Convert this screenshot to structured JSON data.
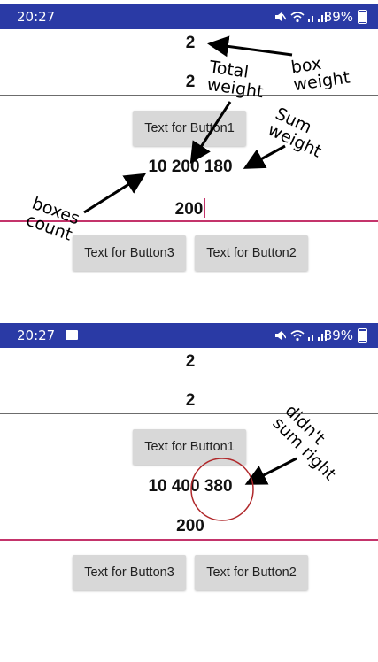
{
  "screen1": {
    "status": {
      "time": "20:27",
      "battery": "89%"
    },
    "box_weight": "2",
    "boxes_count_value": "2",
    "button1": "Text for Button1",
    "sum_text": "10 200 180",
    "input_value": "200",
    "button3": "Text for Button3",
    "button2": "Text for Button2"
  },
  "screen2": {
    "status": {
      "time": "20:27",
      "battery": "89%"
    },
    "box_weight": "2",
    "boxes_count_value": "2",
    "button1": "Text for Button1",
    "sum_text": "10 400 380",
    "input_value": "200",
    "button3": "Text for Button3",
    "button2": "Text for Button2"
  },
  "annotations": {
    "box_weight": "box\nweight",
    "total_weight": "Total\nweight",
    "sum_weight": "Sum\nweight",
    "boxes_count": "boxes\ncount",
    "didnt_sum_right": "didn't\nsum right"
  },
  "colors": {
    "statusbar": "#2a3aa5",
    "accent_line": "#c4346b",
    "button_bg": "#d8d8d8",
    "circle": "#b0282b"
  }
}
